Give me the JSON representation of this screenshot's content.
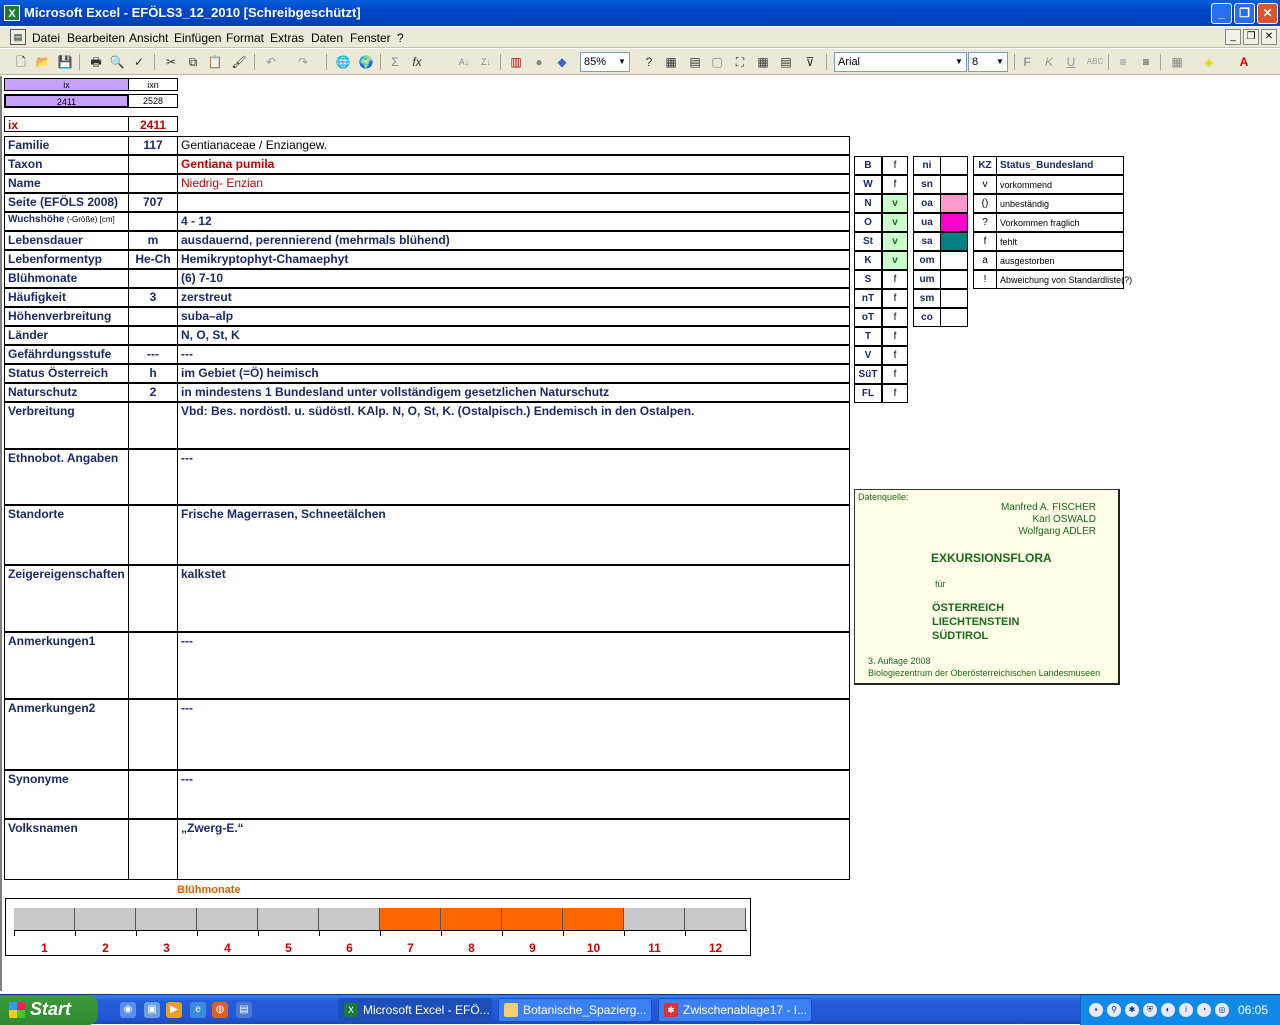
{
  "window": {
    "title": "Microsoft Excel - EFÖLS3_12_2010  [Schreibgeschützt]",
    "app_icon": "excel-icon"
  },
  "menu": [
    "Datei",
    "Bearbeiten",
    "Ansicht",
    "Einfügen",
    "Format",
    "Extras",
    "Daten",
    "Fenster",
    "?"
  ],
  "toolbar": {
    "zoom": "85%",
    "font": "Arial",
    "size": "8"
  },
  "header": {
    "ix_label": "ix",
    "ixn_label": "ixn",
    "ix_value": "2411",
    "ixn_value": "2528",
    "ix_row_label": "ix",
    "ix_row_value": "2411"
  },
  "rows": [
    {
      "label": "Familie",
      "code": "117",
      "value": "Gentianaceae  /  Enziangew."
    },
    {
      "label": "Taxon",
      "code": "",
      "value": "Gentiana pumila"
    },
    {
      "label": "Name",
      "code": "",
      "value": "Niedrig- Enzian"
    },
    {
      "label": "Seite (EFÖLS 2008)",
      "code": "707",
      "value": ""
    },
    {
      "label": "Wuchshöhe",
      "label_small": " (-Größe) [cm]",
      "code": "",
      "value": " 4 - 12"
    },
    {
      "label": "Lebensdauer",
      "code": "m",
      "value": "ausdauernd, perennierend (mehrmals blühend)"
    },
    {
      "label": "Lebenformentyp",
      "code": "He-Ch",
      "value": "Hemikryptophyt-Chamaephyt"
    },
    {
      "label": "Blühmonate",
      "code": "",
      "value": "(6) 7-10"
    },
    {
      "label": "Häufigkeit",
      "code": "3",
      "value": "zerstreut"
    },
    {
      "label": "Höhenverbreitung",
      "code": "",
      "value": "suba–alp"
    },
    {
      "label": "Länder",
      "code": "",
      "value": " N, O, St, K"
    },
    {
      "label": "Gefährdungsstufe",
      "code": "---",
      "value": "  ---"
    },
    {
      "label": "Status Österreich",
      "code": "h",
      "value": "im Gebiet (=Ö) heimisch"
    },
    {
      "label": "Naturschutz",
      "code": "2",
      "value": "in mindestens 1 Bundesland unter vollständigem gesetzlichen Naturschutz"
    },
    {
      "label": "Verbreitung",
      "code": "",
      "value": "Vbd: Bes. nordöstl. u. südöstl. KAlp. N, O, St, K. (Ostalpisch.)  Endemisch in den Ostalpen."
    },
    {
      "label": "Ethnobot. Angaben",
      "code": "",
      "value": "---"
    },
    {
      "label": "Standorte",
      "code": "",
      "value": "Frische Magerrasen, Schneetälchen"
    },
    {
      "label": "Zeigereigenschaften",
      "code": "",
      "value": "kalkstet"
    },
    {
      "label": "Anmerkungen1",
      "code": "",
      "value": "---"
    },
    {
      "label": "Anmerkungen2",
      "code": "",
      "value": "---"
    },
    {
      "label": "Synonyme",
      "code": "",
      "value": "---"
    },
    {
      "label": "Volksnamen",
      "code": "",
      "value": "„Zwerg-E.“"
    }
  ],
  "laender": [
    [
      "B",
      "f"
    ],
    [
      "W",
      "f"
    ],
    [
      "N",
      "v"
    ],
    [
      "O",
      "v"
    ],
    [
      "St",
      "v"
    ],
    [
      "K",
      "v"
    ],
    [
      "S",
      "f"
    ],
    [
      "nT",
      "f"
    ],
    [
      "oT",
      "f"
    ],
    [
      "T",
      "f"
    ],
    [
      "V",
      "f"
    ],
    [
      "SüT",
      "f"
    ],
    [
      "FL",
      "f"
    ]
  ],
  "region_codes": [
    "ni",
    "sn",
    "oa",
    "ua",
    "sa",
    "om",
    "um",
    "sm",
    "co"
  ],
  "region_colors": {
    "oa": "#ff99cc",
    "ua": "#ff00cc",
    "sa": "#008080"
  },
  "status_legend": {
    "header_code": "KZ",
    "header_label": "Status_Bundesland",
    "items": [
      [
        "v",
        "vorkommend"
      ],
      [
        "()",
        "unbeständig"
      ],
      [
        "?",
        "Vorkommen fraglich"
      ],
      [
        "f",
        "fehlt"
      ],
      [
        "a",
        "ausgestorben"
      ],
      [
        "!",
        "Abweichung von Standardliste(?)"
      ]
    ]
  },
  "source": {
    "label": "Datenquelle:",
    "authors": [
      "Manfred A. FISCHER",
      "Karl OSWALD",
      "Wolfgang ADLER"
    ],
    "title": "EXKURSIONSFLORA",
    "fuer": "für",
    "countries": [
      "ÖSTERREICH",
      "LIECHTENSTEIN",
      "SÜDTIROL"
    ],
    "edition": "3. Auflage 2008",
    "publisher": "Biologiezentrum der Oberösterreichischen Landesmuseen"
  },
  "bloom_chart": {
    "title": "Blühmonate",
    "months": [
      "1",
      "2",
      "3",
      "4",
      "5",
      "6",
      "7",
      "8",
      "9",
      "10",
      "11",
      "12"
    ],
    "active": [
      false,
      false,
      false,
      false,
      false,
      false,
      true,
      true,
      true,
      true,
      false,
      false
    ],
    "active_color": "#ff6600",
    "inactive_color": "#c8c8c8"
  },
  "taskbar": {
    "start": "Start",
    "tasks": [
      "Microsoft Excel - EFÖ...",
      "Botanische_Spazierg...",
      "Zwischenablage17 - I..."
    ],
    "clock": "06:05"
  }
}
